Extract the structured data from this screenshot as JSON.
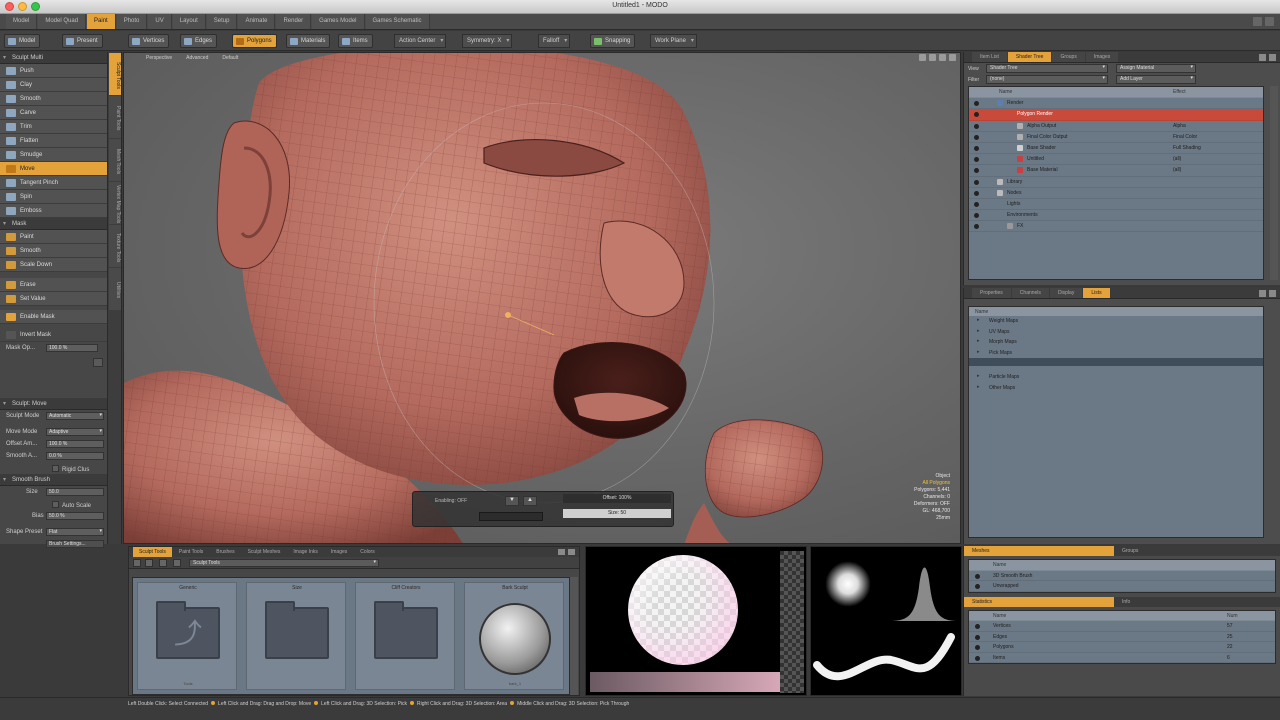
{
  "window": {
    "title": "Untitled1 - MODO"
  },
  "menu_tabs": [
    {
      "label": "Model",
      "active": false
    },
    {
      "label": "Model Quad",
      "active": false
    },
    {
      "label": "Paint",
      "active": true
    },
    {
      "label": "Photo",
      "active": false
    },
    {
      "label": "UV",
      "active": false
    },
    {
      "label": "Layout",
      "active": false
    },
    {
      "label": "Setup",
      "active": false
    },
    {
      "label": "Animate",
      "active": false
    },
    {
      "label": "Render",
      "active": false
    },
    {
      "label": "Games Model",
      "active": false
    },
    {
      "label": "Games Schematic",
      "active": false
    }
  ],
  "toolbar": {
    "model": "Model",
    "present": "Present",
    "vertices": "Vertices",
    "edges": "Edges",
    "polygons": "Polygons",
    "materials": "Materials",
    "items": "Items",
    "action_center": "Action Center",
    "symmetry": "Symmetry: X",
    "falloff": "Falloff",
    "snapping": "Snapping",
    "work_plane": "Work Plane"
  },
  "left_panel": {
    "header": "Sculpt Multi",
    "sculpt_tools": [
      "Push",
      "Clay",
      "Smooth",
      "Carve",
      "Trim",
      "Flatten",
      "Smudge",
      "Move",
      "Tangent Pinch",
      "Spin",
      "Emboss"
    ],
    "active_tool": "Move",
    "mask_header": "Mask",
    "mask_tools": [
      "Paint",
      "Smooth",
      "Scale Down"
    ],
    "extra_tools": [
      "Erase",
      "Set Value"
    ],
    "enable_mask": "Enable Mask",
    "invert_mask": "Invert Mask",
    "mask_op_label": "Mask Op...",
    "mask_op_value": "100.0 %",
    "sculpt_section": "Sculpt: Move",
    "sculpt_mode_label": "Sculpt Mode",
    "sculpt_mode_value": "Automatic",
    "move_mode_label": "Move Mode",
    "move_mode_value": "Adaptive",
    "offset_label": "Offset Am...",
    "offset_value": "100.0 %",
    "smooth_label": "Smooth A...",
    "smooth_value": "0.0 %",
    "rigid_label": "Rigid Clus",
    "smooth_brush_header": "Smooth Brush",
    "size_label": "Size",
    "size_value": "50.0",
    "auto_scale_label": "Auto Scale",
    "bias_label": "Bias",
    "bias_value": "50.0 %",
    "shape_preset_label": "Shape Preset",
    "shape_preset_value": "Flat",
    "brush_settings": "Brush Settings...",
    "vertical_tabs": [
      "Sculpt Tools",
      "Paint Tools",
      "Mesh Tools",
      "Vertex Map Tools",
      "Texture Tools",
      "Utilities"
    ]
  },
  "viewport": {
    "tabs": [
      "Perspective",
      "Advanced",
      "Default"
    ],
    "info": [
      {
        "text": "Object",
        "highlight": false
      },
      {
        "text": "All Polygons",
        "highlight": true
      },
      {
        "text": "Polygons: 5,441",
        "highlight": false
      },
      {
        "text": "Channels: 0",
        "highlight": false
      },
      {
        "text": "Deformers: OFF",
        "highlight": false
      },
      {
        "text": "GL: 468,700",
        "highlight": false
      },
      {
        "text": "25mm",
        "highlight": false
      }
    ],
    "popup_label": "Enabling: OFF",
    "popup_value_top": "Offset: 100%",
    "popup_value_bottom": "Size: 50"
  },
  "shader_tree": {
    "tabs": [
      {
        "label": "Item List",
        "active": false
      },
      {
        "label": "Shader Tree",
        "active": true
      },
      {
        "label": "Groups",
        "active": false
      },
      {
        "label": "Images",
        "active": false
      }
    ],
    "view_label": "View",
    "view_value": "Shader Tree",
    "assign_value": "Assign Material",
    "filter_label": "Filter",
    "filter_value": "(none)",
    "add_layer": "Add Layer",
    "columns": {
      "name": "Name",
      "effect": "Effect"
    },
    "items": [
      {
        "name": "Render",
        "effect": "",
        "indent": 1,
        "selected": false,
        "color": "#5a7fb0"
      },
      {
        "name": "Polygon Render",
        "effect": "",
        "indent": 2,
        "selected": true,
        "color": "#c94a3a"
      },
      {
        "name": "Alpha Output",
        "effect": "Alpha",
        "indent": 3,
        "selected": false,
        "color": "#b0b0b0"
      },
      {
        "name": "Final Color Output",
        "effect": "Final Color",
        "indent": 3,
        "selected": false,
        "color": "#b0b0b0"
      },
      {
        "name": "Base Shader",
        "effect": "Full Shading",
        "indent": 3,
        "selected": false,
        "color": "#d0d0d0"
      },
      {
        "name": "Untitled",
        "effect": "(all)",
        "indent": 3,
        "selected": false,
        "color": "#c84040"
      },
      {
        "name": "Base Material",
        "effect": "(all)",
        "indent": 3,
        "selected": false,
        "color": "#c84040"
      },
      {
        "name": "Library",
        "effect": "",
        "indent": 1,
        "selected": false,
        "color": "#bbbbbb"
      },
      {
        "name": "Nodes",
        "effect": "",
        "indent": 1,
        "selected": false,
        "color": "#bbbbbb"
      },
      {
        "name": "Lights",
        "effect": "",
        "indent": 1,
        "selected": false,
        "color": ""
      },
      {
        "name": "Environments",
        "effect": "",
        "indent": 1,
        "selected": false,
        "color": ""
      },
      {
        "name": "FX",
        "effect": "",
        "indent": 2,
        "selected": false,
        "color": "#999999"
      }
    ]
  },
  "lists_panel": {
    "tabs": [
      {
        "label": "Properties",
        "active": false
      },
      {
        "label": "Channels",
        "active": false
      },
      {
        "label": "Display",
        "active": false
      },
      {
        "label": "Lists",
        "active": true
      }
    ],
    "column": "Name",
    "items": [
      "Weight Maps",
      "UV Maps",
      "Morph Maps",
      "Pick Maps"
    ],
    "items_after": [
      "Particle Maps",
      "Other Maps"
    ]
  },
  "bottom_right": {
    "tabs1": [
      {
        "label": "Meshes",
        "active": true
      },
      {
        "label": "Groups",
        "active": false
      }
    ],
    "col1": "Name",
    "rows1": [
      {
        "name": "3D Smooth Brush",
        "count": ""
      },
      {
        "name": "Unwrapped",
        "count": ""
      }
    ],
    "tabs2": [
      {
        "label": "Statistics",
        "active": true
      },
      {
        "label": "Info",
        "active": false
      }
    ],
    "col2": "Name",
    "col2b": "Num",
    "rows2": [
      {
        "name": "Vertices",
        "count": "57"
      },
      {
        "name": "Edges",
        "count": "25"
      },
      {
        "name": "Polygons",
        "count": "22"
      },
      {
        "name": "Items",
        "count": "6"
      }
    ]
  },
  "bottom_tools": {
    "tabs": [
      {
        "label": "Sculpt Tools",
        "active": true
      },
      {
        "label": "Paint Tools",
        "active": false
      },
      {
        "label": "Brushes",
        "active": false
      },
      {
        "label": "Sculpt Meshes",
        "active": false
      },
      {
        "label": "Image Inks",
        "active": false
      },
      {
        "label": "Images",
        "active": false
      },
      {
        "label": "Colors",
        "active": false
      }
    ],
    "path": "Sculpt Tools",
    "tiles": [
      {
        "name": "Generic",
        "footer": "Tools",
        "kind": "up"
      },
      {
        "name": "Size",
        "footer": "",
        "kind": "folder"
      },
      {
        "name": "Cliff Creators",
        "footer": "",
        "kind": "folder"
      },
      {
        "name": "Bark Sculpt",
        "footer": "bark_1",
        "kind": "sphere"
      }
    ]
  },
  "status_bar": {
    "items": [
      "Left Double Click: Select Connected",
      "Left Click and Drag: Drag and Drop: Move",
      "Left Click and Drag: 3D Selection: Pick",
      "Right Click and Drag: 3D Selection: Area",
      "Middle Click and Drag: 3D Selection: Pick Through"
    ]
  },
  "colors": {
    "accent": "#e3a23a",
    "skin": "#b46a5e",
    "wire": "#6b2f2a"
  }
}
